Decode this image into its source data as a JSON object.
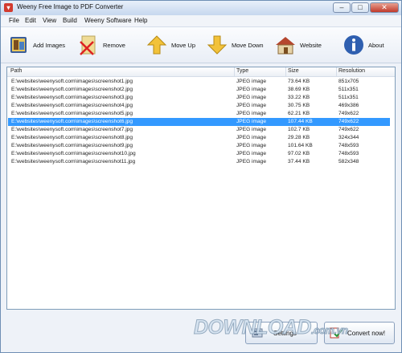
{
  "window": {
    "title": "Weeny Free Image to PDF Converter"
  },
  "menu": [
    "File",
    "Edit",
    "View",
    "Build",
    "Weeny Software",
    "Help"
  ],
  "toolbar": {
    "add_images": "Add Images",
    "remove": "Remove",
    "move_up": "Move Up",
    "move_down": "Move Down",
    "website": "Website",
    "about": "About"
  },
  "table": {
    "headers": {
      "path": "Path",
      "type": "Type",
      "size": "Size",
      "resolution": "Resolution"
    },
    "selected_index": 5,
    "rows": [
      {
        "path": "E:\\websites\\weenysoft.com\\images\\screenshot1.jpg",
        "type": "JPEG image",
        "size": "73.64 KB",
        "resolution": "851x705"
      },
      {
        "path": "E:\\websites\\weenysoft.com\\images\\screenshot2.jpg",
        "type": "JPEG image",
        "size": "38.69 KB",
        "resolution": "511x351"
      },
      {
        "path": "E:\\websites\\weenysoft.com\\images\\screenshot3.jpg",
        "type": "JPEG image",
        "size": "33.22 KB",
        "resolution": "511x351"
      },
      {
        "path": "E:\\websites\\weenysoft.com\\images\\screenshot4.jpg",
        "type": "JPEG image",
        "size": "30.75 KB",
        "resolution": "469x386"
      },
      {
        "path": "E:\\websites\\weenysoft.com\\images\\screenshot5.jpg",
        "type": "JPEG image",
        "size": "62.21 KB",
        "resolution": "749x622"
      },
      {
        "path": "E:\\websites\\weenysoft.com\\images\\screenshot6.jpg",
        "type": "JPEG image",
        "size": "107.44 KB",
        "resolution": "749x622"
      },
      {
        "path": "E:\\websites\\weenysoft.com\\images\\screenshot7.jpg",
        "type": "JPEG image",
        "size": "102.7 KB",
        "resolution": "749x622"
      },
      {
        "path": "E:\\websites\\weenysoft.com\\images\\screenshot8.jpg",
        "type": "JPEG image",
        "size": "29.28 KB",
        "resolution": "324x344"
      },
      {
        "path": "E:\\websites\\weenysoft.com\\images\\screenshot9.jpg",
        "type": "JPEG image",
        "size": "101.64 KB",
        "resolution": "748x593"
      },
      {
        "path": "E:\\websites\\weenysoft.com\\images\\screenshot10.jpg",
        "type": "JPEG image",
        "size": "97.02 KB",
        "resolution": "748x593"
      },
      {
        "path": "E:\\websites\\weenysoft.com\\images\\screenshot11.jpg",
        "type": "JPEG image",
        "size": "37.44 KB",
        "resolution": "582x348"
      }
    ]
  },
  "bottom": {
    "settings": "Settings",
    "convert": "Convert now!"
  },
  "watermark": {
    "main": "DOWNLOAD",
    "suffix": ".com.vn"
  },
  "colors": {
    "selection": "#3399ff",
    "accent": "#2f6db5"
  }
}
